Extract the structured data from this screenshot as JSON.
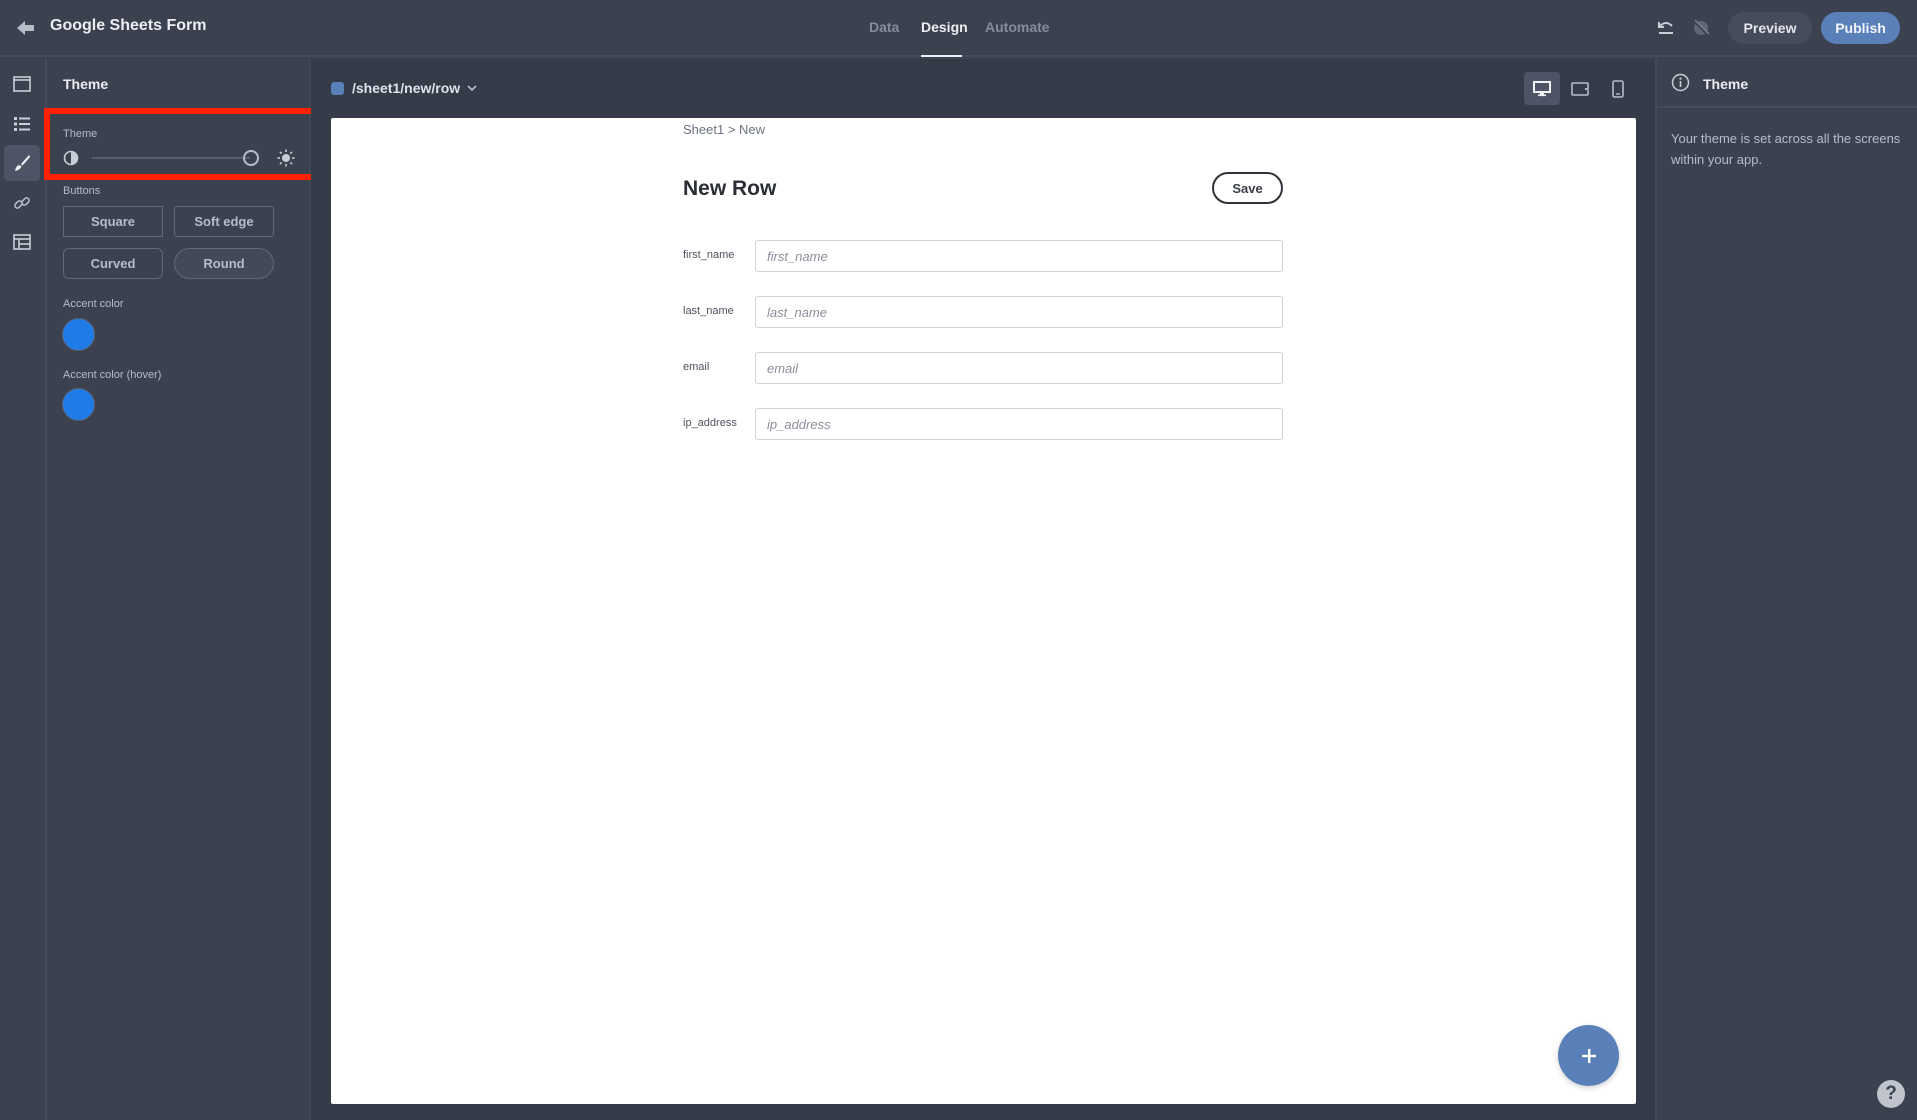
{
  "header": {
    "app_title": "Google Sheets Form",
    "back_icon": "arrow-left-icon",
    "tabs": [
      {
        "label": "Data",
        "active": false
      },
      {
        "label": "Design",
        "active": true
      },
      {
        "label": "Automate",
        "active": false
      }
    ],
    "undo_icon": "undo-icon",
    "redo_icon": "redo-disabled-icon",
    "preview_label": "Preview",
    "publish_label": "Publish"
  },
  "rail": {
    "items": [
      {
        "icon": "screen-icon",
        "active": false
      },
      {
        "icon": "list-icon",
        "active": false
      },
      {
        "icon": "paintbrush-icon",
        "active": true
      },
      {
        "icon": "link-icon",
        "active": false
      },
      {
        "icon": "table-icon",
        "active": false
      }
    ]
  },
  "left_panel": {
    "title": "Theme",
    "theme_label": "Theme",
    "theme_slider_value": 1.0,
    "theme_slider_left_icon": "contrast-icon",
    "theme_slider_right_icon": "sun-icon",
    "buttons_label": "Buttons",
    "button_styles": [
      "Square",
      "Soft edge",
      "Curved",
      "Round"
    ],
    "accent_label": "Accent color",
    "accent_color": "#1f7be8",
    "accent_hover_label": "Accent color (hover)",
    "accent_hover_color": "#1f7be8"
  },
  "canvas": {
    "route": "/sheet1/new/row",
    "route_color": "#5a80b9",
    "devices": [
      {
        "icon": "desktop-icon",
        "active": true
      },
      {
        "icon": "tablet-icon",
        "active": false
      },
      {
        "icon": "mobile-icon",
        "active": false
      }
    ],
    "breadcrumb": "Sheet1 > New",
    "form_title": "New Row",
    "save_label": "Save",
    "fields": [
      {
        "label": "first_name",
        "placeholder": "first_name",
        "value": ""
      },
      {
        "label": "last_name",
        "placeholder": "last_name",
        "value": ""
      },
      {
        "label": "email",
        "placeholder": "email",
        "value": ""
      },
      {
        "label": "ip_address",
        "placeholder": "ip_address",
        "value": ""
      }
    ],
    "fab_icon": "plus-icon"
  },
  "right_panel": {
    "title": "Theme",
    "description": "Your theme is set across all the screens within your app.",
    "help_label": "?"
  },
  "colors": {
    "primary": "#5a80b9",
    "highlight": "#ff2200"
  }
}
